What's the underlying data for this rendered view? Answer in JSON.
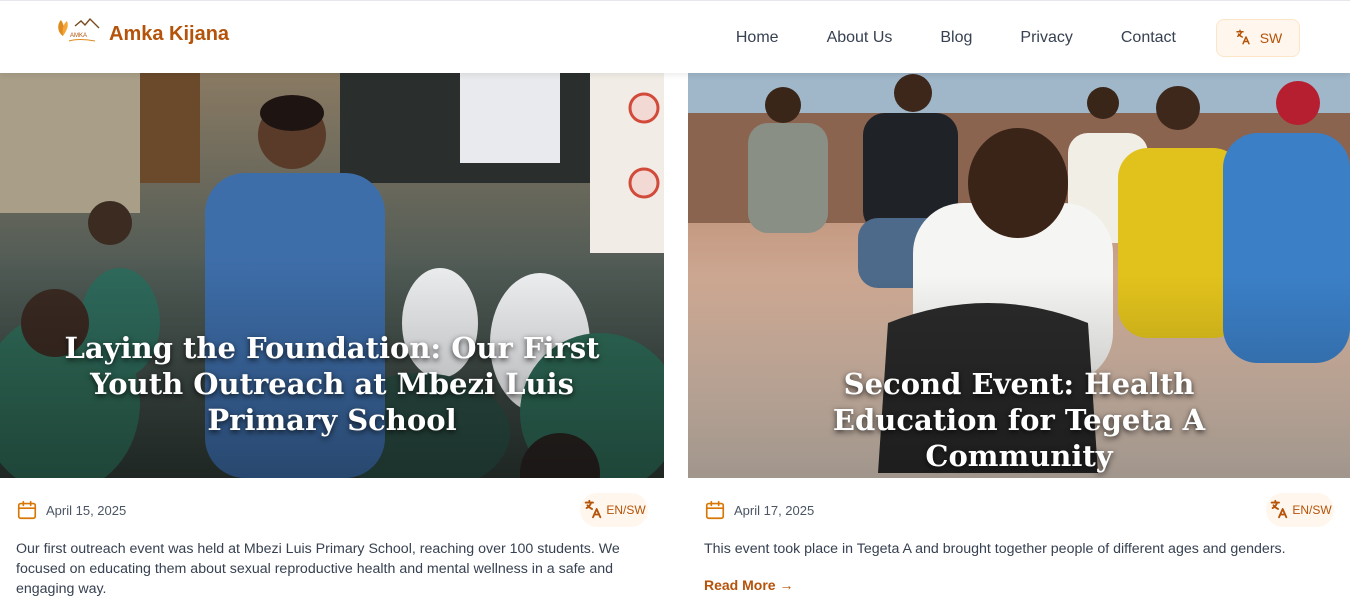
{
  "brand": {
    "name": "Amka Kijana",
    "logo_text": "AMKA"
  },
  "nav": {
    "items": [
      {
        "label": "Home"
      },
      {
        "label": "About Us"
      },
      {
        "label": "Blog"
      },
      {
        "label": "Privacy"
      },
      {
        "label": "Contact"
      }
    ],
    "language_label": "SW"
  },
  "posts": [
    {
      "title": "Laying the Foundation: Our First Youth Outreach at Mbezi Luis Primary School",
      "date": "April 15, 2025",
      "lang_badge": "EN/SW",
      "excerpt": "Our first outreach event was held at Mbezi Luis Primary School, reaching over 100 students. We focused on educating them about sexual reproductive health and mental wellness in a safe and engaging way."
    },
    {
      "title": "Second Event: Health Education for Tegeta A Community",
      "date": "April 17, 2025",
      "lang_badge": "EN/SW",
      "excerpt": "This event took place in Tegeta A and brought together people of different ages and genders.",
      "read_more": "Read More →"
    }
  ],
  "colors": {
    "accent": "#b45309",
    "badge_bg": "#fff7ed"
  },
  "icons": {
    "language": "translate-icon",
    "date": "calendar-icon"
  }
}
